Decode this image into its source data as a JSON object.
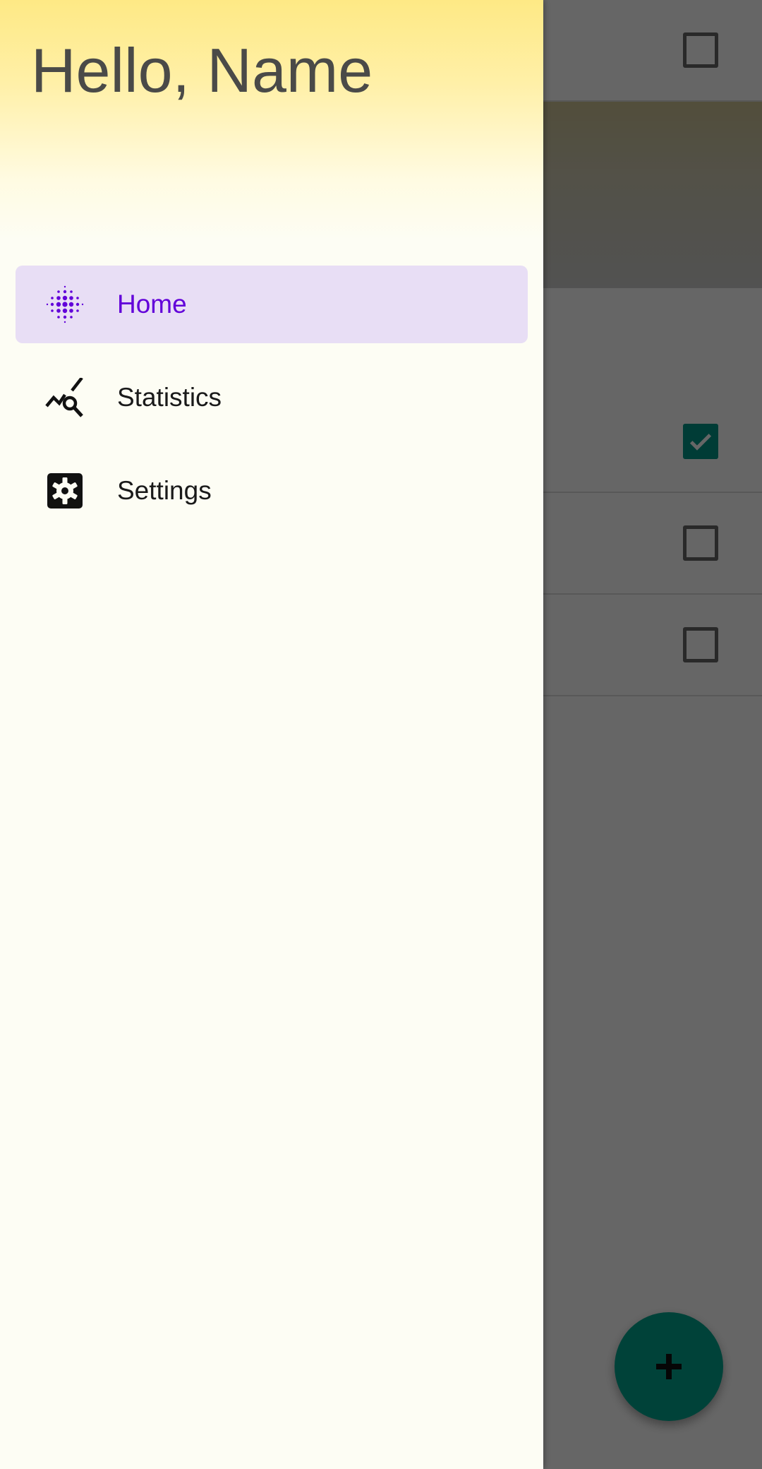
{
  "drawer": {
    "greeting": "Hello, Name",
    "items": [
      {
        "label": "Home",
        "icon": "home-dots-icon",
        "active": true
      },
      {
        "label": "Statistics",
        "icon": "chart-search-icon",
        "active": false
      },
      {
        "label": "Settings",
        "icon": "gear-icon",
        "active": false
      }
    ]
  },
  "background_list": {
    "rows": [
      {
        "checked": true
      },
      {
        "checked": false
      },
      {
        "checked": false
      },
      {
        "checked": false
      }
    ]
  },
  "fab": {
    "icon": "plus-icon"
  },
  "colors": {
    "accent": "#6200d9",
    "active_item_bg": "#e8def5",
    "fab": "#00a58f",
    "drawer_bg": "#fdfdf4",
    "header_gradient_top": "#fee985"
  }
}
